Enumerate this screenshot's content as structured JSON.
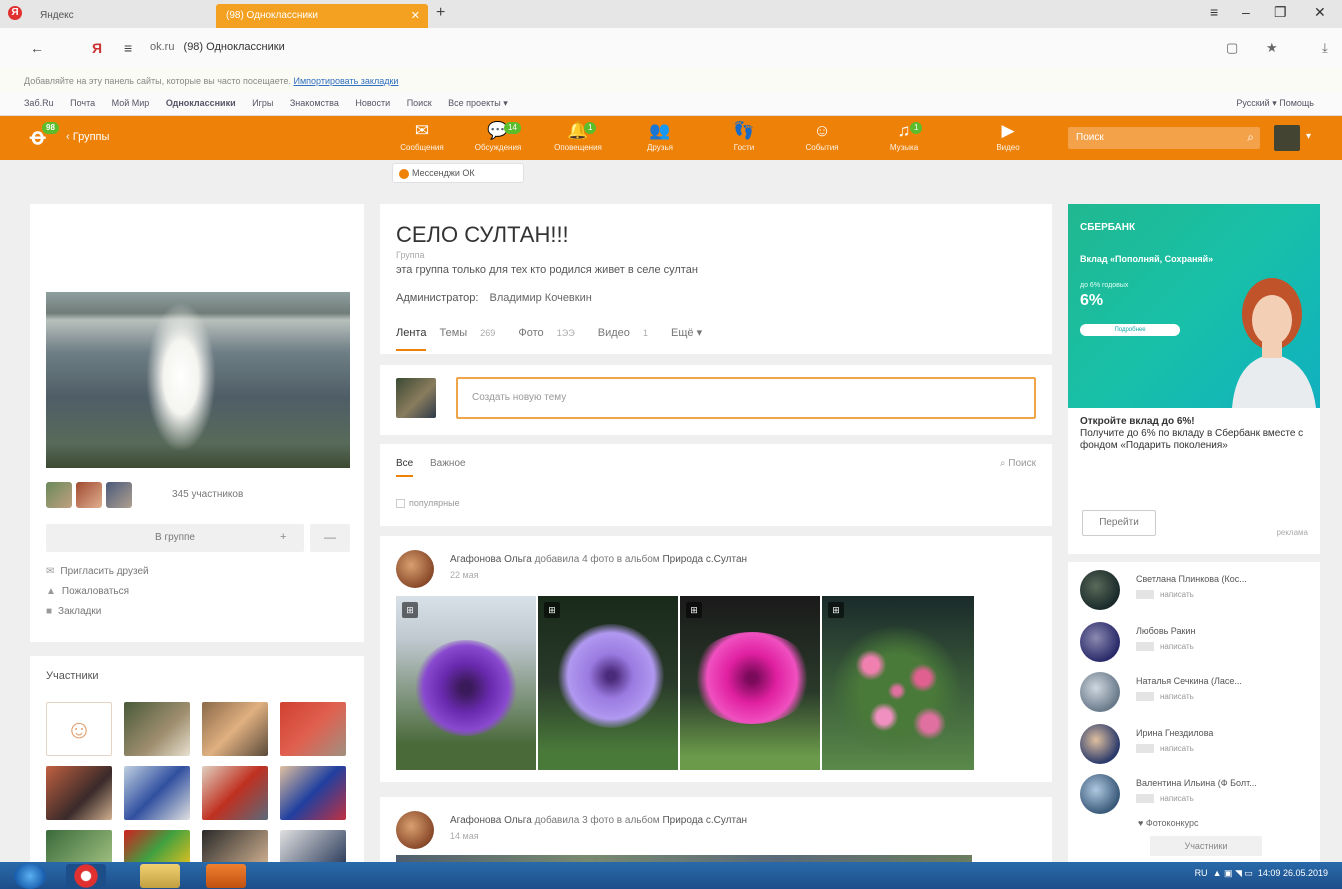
{
  "browser": {
    "tabs": [
      {
        "label": "Яндекс"
      },
      {
        "label": "(98) Одноклассники"
      }
    ],
    "url_domain": "ok.ru",
    "url_title": "(98) Одноклассники",
    "infobar_text": "Добавляйте на эту панель сайты, которые вы часто посещаете.",
    "infobar_link": "Импортировать закладки",
    "bookmarks": [
      "Заб.Ru",
      "Почта",
      "Мой Мир",
      "Одноклассники",
      "Игры",
      "Знакомства",
      "Новости",
      "Поиск",
      "Все проекты ▾"
    ],
    "bookmarks_right": "Русский ▾  Помощь"
  },
  "ok": {
    "back_label": "Группы",
    "logo_badge": "98",
    "nav": [
      {
        "icon": "✉",
        "label": "Сообщения",
        "badge": ""
      },
      {
        "icon": "💬",
        "label": "Обсуждения",
        "badge": "14"
      },
      {
        "icon": "🔔",
        "label": "Оповещения",
        "badge": "1"
      },
      {
        "icon": "👥",
        "label": "Друзья",
        "badge": ""
      },
      {
        "icon": "👣",
        "label": "Гости",
        "badge": ""
      },
      {
        "icon": "☺",
        "label": "События",
        "badge": ""
      },
      {
        "icon": "♫",
        "label": "Музыка",
        "badge": "1"
      },
      {
        "icon": "▶",
        "label": "Видео",
        "badge": ""
      }
    ],
    "search_placeholder": "Поиск",
    "promo_chip": "Мессенджи ОК"
  },
  "group": {
    "title": "СЕЛО СУЛТАН!!!",
    "type": "Группа",
    "description": "эта группа только для тех кто родился живет в селе султан",
    "admin_label": "Администратор:",
    "admin_name": "Владимир Кочевкин",
    "tabs": [
      {
        "label": "Лента",
        "count": ""
      },
      {
        "label": "Темы",
        "count": "269"
      },
      {
        "label": "Фото",
        "count": "1ЭЭ"
      },
      {
        "label": "Видео",
        "count": "1"
      },
      {
        "label": "Ещё ▾",
        "count": ""
      }
    ],
    "members_count": "345 участников",
    "join_label": "В группе",
    "links": [
      "Пригласить друзей",
      "Пожаловаться",
      "Закладки"
    ],
    "members_title": "Участники"
  },
  "compose": {
    "placeholder": "Создать новую тему"
  },
  "filter": {
    "tabs": [
      "Все",
      "Важное"
    ],
    "search_label": "Поиск",
    "popular_label": "популярные"
  },
  "posts": [
    {
      "author": "Агафонова Ольга",
      "action": "добавила 4 фото в альбом",
      "album": "Природа с.Султан",
      "time": "22 мая"
    },
    {
      "author": "Агафонова Ольга",
      "action": "добавила 3 фото в альбом",
      "album": "Природа с.Султан",
      "time": "14 мая"
    }
  ],
  "ad": {
    "brand": "СБЕРБАНК",
    "headline": "Вклад «Пополняй, Сохраняй»",
    "sub": "до 6% годовых",
    "percent": "6%",
    "button": "Подробнее",
    "title": "Откройте вклад до 6%!",
    "text": "Получите до 6% по вкладу в Сбербанк вместе с фондом «Подарить поколения»",
    "go_label": "Перейти",
    "tag": "реклама"
  },
  "friends": [
    {
      "name": "Светлана Плинкова (Кос...",
      "action": "написать"
    },
    {
      "name": "Любовь Ракин",
      "action": "написать"
    },
    {
      "name": "Наталья Сечкина (Ласе...",
      "action": "написать"
    },
    {
      "name": "Ирина Гнездилова",
      "action": "написать"
    },
    {
      "name": "Валентина Ильина (Ф Болт...",
      "action": "написать"
    }
  ],
  "fotos_link": "Фотоконкурс",
  "members_button": "Участники",
  "taskbar": {
    "tray_lang": "RU",
    "time": "14:09",
    "date": "26.05.2019"
  }
}
